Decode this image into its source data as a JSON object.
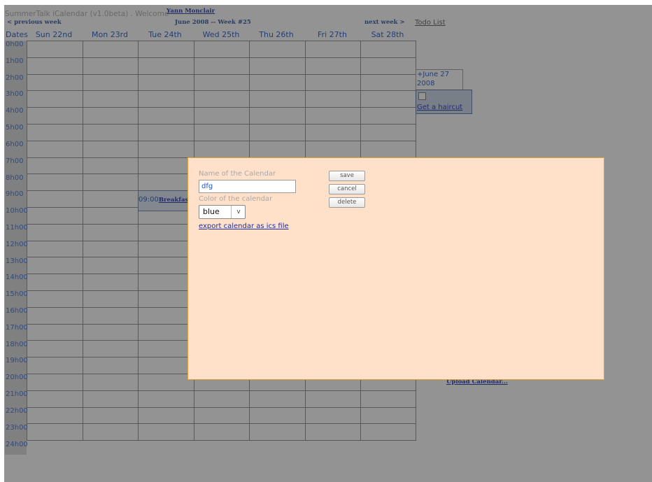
{
  "header": {
    "app_title": "SummerTalk iCalendar (v1.0beta) . Welcome",
    "user_name": "Yann Monclair",
    "prev_week": "< previous week",
    "week_label": "June 2008 -- Week #25",
    "next_week": "next week >",
    "todo_list": "Todo List"
  },
  "calendar": {
    "dates_label": "Dates",
    "days": [
      "Sun 22nd",
      "Mon 23rd",
      "Tue 24th",
      "Wed 25th",
      "Thu 26th",
      "Fri 27th",
      "Sat 28th"
    ],
    "hours": [
      "0h00",
      "1h00",
      "2h00",
      "3h00",
      "4h00",
      "5h00",
      "6h00",
      "7h00",
      "8h00",
      "9h00",
      "10h00",
      "11h00",
      "12h00",
      "13h00",
      "14h00",
      "15h00",
      "16h00",
      "17h00",
      "18h00",
      "19h00",
      "20h00",
      "21h00",
      "22h00",
      "23h00",
      "24h00"
    ],
    "event": {
      "time": "09:00",
      "title": "Breakfast"
    }
  },
  "todo": {
    "date_label": "+June 27 2008",
    "item_label": "Get a haircut"
  },
  "upload_link": "Upload Calendar...",
  "dialog": {
    "name_label": "Name of the Calendar",
    "name_value": "dfg",
    "color_label": "Color of the calendar",
    "color_value": "blue",
    "color_caret": "v",
    "export_link": "export calendar as ics file",
    "save_label": "save",
    "cancel_label": "cancel",
    "delete_label": "delete"
  },
  "colors": {
    "dialog_bg": "#ffe1c9",
    "dialog_border": "#e0a040",
    "overlay": "#7f7f7f",
    "link": "#1a2fa8"
  }
}
